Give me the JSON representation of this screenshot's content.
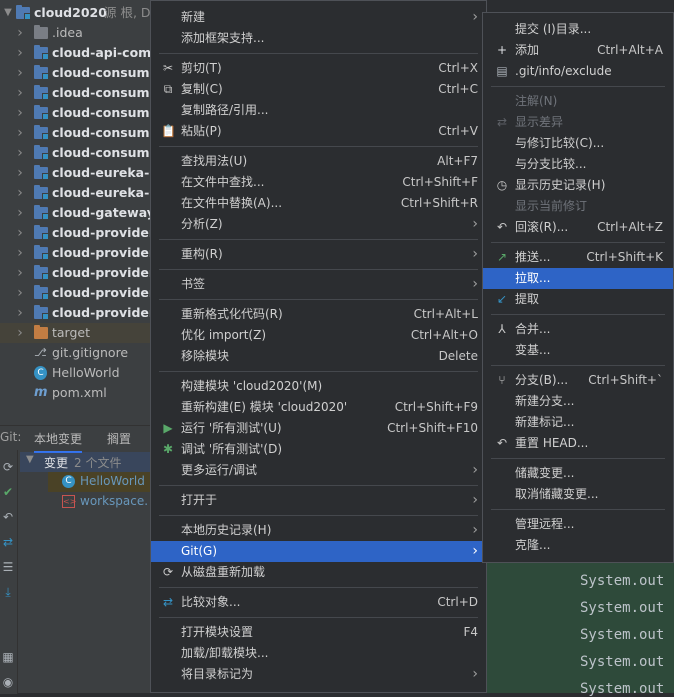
{
  "project": {
    "root_name": "cloud2020",
    "root_suffix": "源 根, D",
    "items": [
      {
        "label": ".idea",
        "kind": "dark",
        "arrow": true
      },
      {
        "label": "cloud-api-comm",
        "kind": "mod",
        "arrow": true
      },
      {
        "label": "cloud-consumer",
        "kind": "mod",
        "arrow": true
      },
      {
        "label": "cloud-consumer",
        "kind": "mod",
        "arrow": true
      },
      {
        "label": "cloud-consumer",
        "kind": "mod",
        "arrow": true
      },
      {
        "label": "cloud-consumer",
        "kind": "mod",
        "arrow": true
      },
      {
        "label": "cloud-consumer",
        "kind": "mod",
        "arrow": true
      },
      {
        "label": "cloud-eureka-se",
        "kind": "mod",
        "arrow": true
      },
      {
        "label": "cloud-eureka-se",
        "kind": "mod",
        "arrow": true
      },
      {
        "label": "cloud-gateway-",
        "kind": "mod",
        "arrow": true
      },
      {
        "label": "cloud-provider-",
        "kind": "mod",
        "arrow": true
      },
      {
        "label": "cloud-provider-",
        "kind": "mod",
        "arrow": true
      },
      {
        "label": "cloud-provider-",
        "kind": "mod",
        "arrow": true
      },
      {
        "label": "cloud-provider-",
        "kind": "mod",
        "arrow": true
      },
      {
        "label": "cloud-provider-",
        "kind": "mod",
        "arrow": true
      },
      {
        "label": "target",
        "kind": "orange",
        "arrow": true
      },
      {
        "label": "git.gitignore",
        "kind": "git",
        "arrow": false
      },
      {
        "label": "HelloWorld",
        "kind": "java",
        "arrow": false
      },
      {
        "label": "pom.xml",
        "kind": "maven",
        "arrow": false
      }
    ]
  },
  "git_panel": {
    "prefix": "Git:",
    "tab_local_changes": "本地变更",
    "tab_shelf": "搁置",
    "changes_label": "变更",
    "changes_count": "2 个文件",
    "files": [
      "HelloWorld",
      "workspace."
    ]
  },
  "menu1": [
    {
      "label": "新建",
      "key": "",
      "sub": true
    },
    {
      "label": "添加框架支持...",
      "key": ""
    },
    {
      "sep": true
    },
    {
      "label": "剪切(T)",
      "key": "Ctrl+X",
      "icon": "cut-icon"
    },
    {
      "label": "复制(C)",
      "key": "Ctrl+C",
      "icon": "copy-icon"
    },
    {
      "label": "复制路径/引用...",
      "key": ""
    },
    {
      "label": "粘贴(P)",
      "key": "Ctrl+V",
      "icon": "paste-icon"
    },
    {
      "sep": true
    },
    {
      "label": "查找用法(U)",
      "key": "Alt+F7"
    },
    {
      "label": "在文件中查找...",
      "key": "Ctrl+Shift+F"
    },
    {
      "label": "在文件中替换(A)...",
      "key": "Ctrl+Shift+R"
    },
    {
      "label": "分析(Z)",
      "key": "",
      "sub": true
    },
    {
      "sep": true
    },
    {
      "label": "重构(R)",
      "key": "",
      "sub": true
    },
    {
      "sep": true
    },
    {
      "label": "书签",
      "key": "",
      "sub": true
    },
    {
      "sep": true
    },
    {
      "label": "重新格式化代码(R)",
      "key": "Ctrl+Alt+L"
    },
    {
      "label": "优化 import(Z)",
      "key": "Ctrl+Alt+O"
    },
    {
      "label": "移除模块",
      "key": "Delete"
    },
    {
      "sep": true
    },
    {
      "label": "构建模块 'cloud2020'(M)",
      "key": ""
    },
    {
      "label": "重新构建(E) 模块 'cloud2020'",
      "key": "Ctrl+Shift+F9"
    },
    {
      "label": "运行 '所有测试'(U)",
      "key": "Ctrl+Shift+F10",
      "icon": "run-icon"
    },
    {
      "label": "调试 '所有测试'(D)",
      "key": "",
      "icon": "debug-icon"
    },
    {
      "label": "更多运行/调试",
      "key": "",
      "sub": true
    },
    {
      "sep": true
    },
    {
      "label": "打开于",
      "key": "",
      "sub": true
    },
    {
      "sep": true
    },
    {
      "label": "本地历史记录(H)",
      "key": "",
      "sub": true
    },
    {
      "label": "Git(G)",
      "key": "",
      "sub": true,
      "selected": true
    },
    {
      "label": "从磁盘重新加载",
      "key": "",
      "icon": "reload-icon"
    },
    {
      "sep": true
    },
    {
      "label": "比较对象...",
      "key": "Ctrl+D",
      "icon": "compare-icon"
    },
    {
      "sep": true
    },
    {
      "label": "打开模块设置",
      "key": "F4"
    },
    {
      "label": "加载/卸载模块...",
      "key": ""
    },
    {
      "label": "将目录标记为",
      "key": "",
      "sub": true
    }
  ],
  "menu2": [
    {
      "label": "提交 (I)目录...",
      "key": ""
    },
    {
      "label": "添加",
      "key": "Ctrl+Alt+A",
      "icon": "add-icon"
    },
    {
      "label": ".git/info/exclude",
      "key": "",
      "icon": "exclude-icon"
    },
    {
      "sep": true
    },
    {
      "label": "注解(N)",
      "key": "",
      "disabled": true
    },
    {
      "label": "显示差异",
      "key": "",
      "disabled": true,
      "icon": "diff-icon"
    },
    {
      "label": "与修订比较(C)...",
      "key": ""
    },
    {
      "label": "与分支比较...",
      "key": ""
    },
    {
      "label": "显示历史记录(H)",
      "key": "",
      "icon": "history-icon"
    },
    {
      "label": "显示当前修订",
      "key": "",
      "disabled": true
    },
    {
      "label": "回滚(R)...",
      "key": "Ctrl+Alt+Z",
      "icon": "rollback-icon"
    },
    {
      "sep": true
    },
    {
      "label": "推送...",
      "key": "Ctrl+Shift+K",
      "icon": "push-icon"
    },
    {
      "label": "拉取...",
      "key": "",
      "selected": true
    },
    {
      "label": "提取",
      "key": "",
      "icon": "fetch-icon"
    },
    {
      "sep": true
    },
    {
      "label": "合并...",
      "key": "",
      "icon": "merge-icon"
    },
    {
      "label": "变基...",
      "key": ""
    },
    {
      "sep": true
    },
    {
      "label": "分支(B)...",
      "key": "Ctrl+Shift+`",
      "icon": "branch-icon"
    },
    {
      "label": "新建分支...",
      "key": ""
    },
    {
      "label": "新建标记...",
      "key": ""
    },
    {
      "label": "重置 HEAD...",
      "key": "",
      "icon": "reset-icon"
    },
    {
      "sep": true
    },
    {
      "label": "储藏变更...",
      "key": ""
    },
    {
      "label": "取消储藏变更...",
      "key": ""
    },
    {
      "sep": true
    },
    {
      "label": "管理远程...",
      "key": ""
    },
    {
      "label": "克隆...",
      "key": ""
    }
  ],
  "editor": {
    "lines": [
      "System.out",
      "System.out",
      "System.out",
      "System.out",
      "System.out"
    ]
  }
}
